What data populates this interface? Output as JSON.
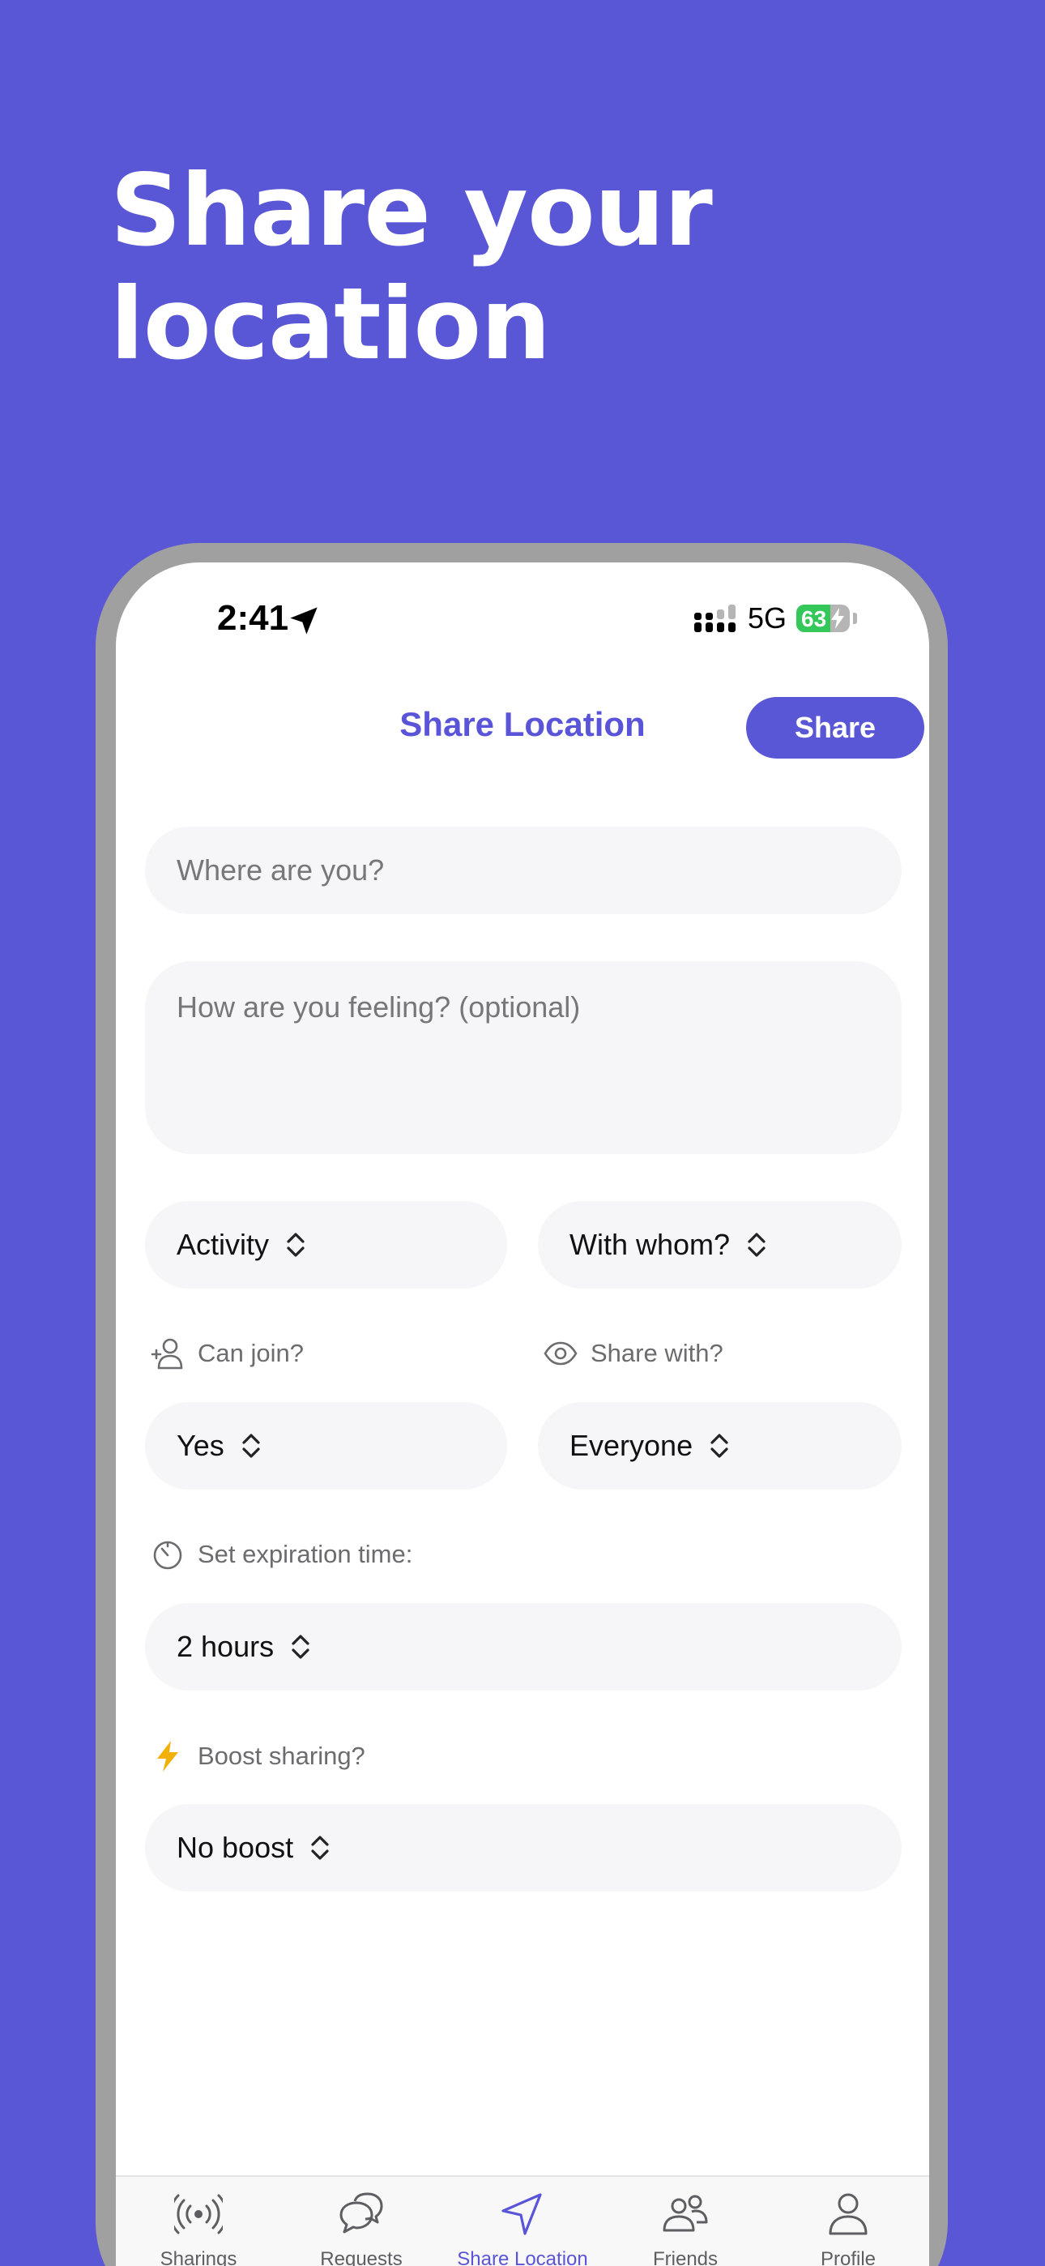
{
  "promo": {
    "headline_line1": "Share your",
    "headline_line2": "location"
  },
  "status_bar": {
    "time": "2:41",
    "network": "5G",
    "battery": "63",
    "battery_level_percent": 63
  },
  "header": {
    "title": "Share Location",
    "share_button": "Share"
  },
  "form": {
    "where": {
      "placeholder": "Where are you?",
      "value": ""
    },
    "feeling": {
      "placeholder": "How are you feeling? (optional)",
      "value": ""
    },
    "activity": "Activity",
    "with_whom": "With whom?",
    "can_join_label": "Can join?",
    "can_join_value": "Yes",
    "share_with_label": "Share with?",
    "share_with_value": "Everyone",
    "expiration_label": "Set expiration time:",
    "expiration_value": "2 hours",
    "boost_label": "Boost sharing?",
    "boost_value": "No boost"
  },
  "tabs": [
    {
      "label": "Sharings",
      "icon": "broadcast-icon",
      "active": false
    },
    {
      "label": "Requests",
      "icon": "chat-bubbles-icon",
      "active": false
    },
    {
      "label": "Share Location",
      "icon": "location-arrow-icon",
      "active": true
    },
    {
      "label": "Friends",
      "icon": "friends-icon",
      "active": false
    },
    {
      "label": "Profile",
      "icon": "person-icon",
      "active": false
    }
  ],
  "colors": {
    "brand": "#5957D6",
    "accent_text": "#5A55D8",
    "boost_icon": "#F2B10A",
    "battery": "#34C759"
  }
}
